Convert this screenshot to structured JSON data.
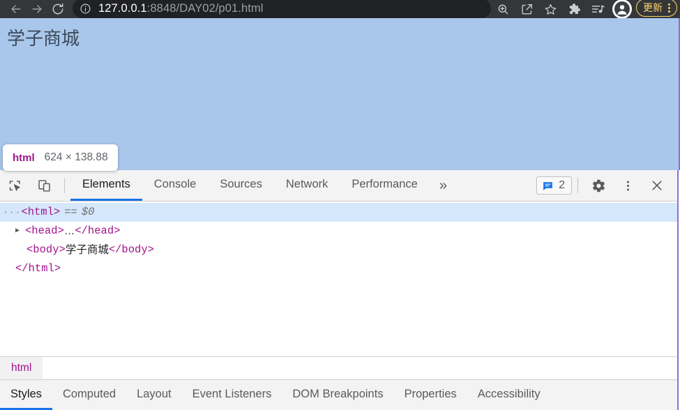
{
  "browser": {
    "nav": {
      "back": "back-arrow",
      "forward": "forward-arrow",
      "reload": "reload"
    },
    "omnibox": {
      "info_icon": "site-info-icon",
      "url_host": "127.0.0.1",
      "url_rest": ":8848/DAY02/p01.html"
    },
    "toolbar_icons": [
      "zoom-in-icon",
      "share-icon",
      "bookmark-star-icon",
      "extensions-puzzle-icon",
      "reading-list-icon"
    ],
    "profile": "profile-avatar-icon",
    "update_button": {
      "label": "更新",
      "border_color": "#fdd663",
      "text_color": "#fdd663"
    }
  },
  "page": {
    "heading": "学子商城",
    "background_color": "#a8c7ea",
    "text_color": "#3c4a5c"
  },
  "inspect_tooltip": {
    "tag": "html",
    "dimensions": "624 × 138.88"
  },
  "devtools": {
    "toolbar_icons": {
      "inspect": "inspect-element-icon",
      "device": "device-toolbar-icon"
    },
    "tabs": [
      {
        "label": "Elements",
        "active": true
      },
      {
        "label": "Console",
        "active": false
      },
      {
        "label": "Sources",
        "active": false
      },
      {
        "label": "Network",
        "active": false
      },
      {
        "label": "Performance",
        "active": false
      }
    ],
    "overflow": "»",
    "issues": {
      "icon": "issues-message-icon",
      "count": "2",
      "color": "#1a73e8"
    },
    "right_icons": {
      "settings": "gear-icon",
      "menu": "kebab-menu-icon",
      "close": "close-icon"
    },
    "dom_tree": [
      {
        "indent": 0,
        "ellipsis": "···",
        "twisty": "",
        "open_tag": "<html>",
        "text": "",
        "close_tag": "",
        "eq": "==",
        "dollar": "$0",
        "selected": true
      },
      {
        "indent": 1,
        "ellipsis": "",
        "twisty": "▶",
        "open_tag": "<head>",
        "text": "…",
        "close_tag": "</head>",
        "eq": "",
        "dollar": "",
        "selected": false
      },
      {
        "indent": 2,
        "ellipsis": "",
        "twisty": "",
        "open_tag": "<body>",
        "text": "学子商城 ",
        "close_tag": "</body>",
        "eq": "",
        "dollar": "",
        "selected": false
      },
      {
        "indent": 1,
        "ellipsis": "",
        "twisty": "",
        "open_tag": "</html>",
        "text": "",
        "close_tag": "",
        "eq": "",
        "dollar": "",
        "selected": false
      }
    ],
    "breadcrumb": [
      {
        "label": "html"
      }
    ],
    "sub_tabs": [
      {
        "label": "Styles",
        "active": true
      },
      {
        "label": "Computed",
        "active": false
      },
      {
        "label": "Layout",
        "active": false
      },
      {
        "label": "Event Listeners",
        "active": false
      },
      {
        "label": "DOM Breakpoints",
        "active": false
      },
      {
        "label": "Properties",
        "active": false
      },
      {
        "label": "Accessibility",
        "active": false
      }
    ]
  }
}
